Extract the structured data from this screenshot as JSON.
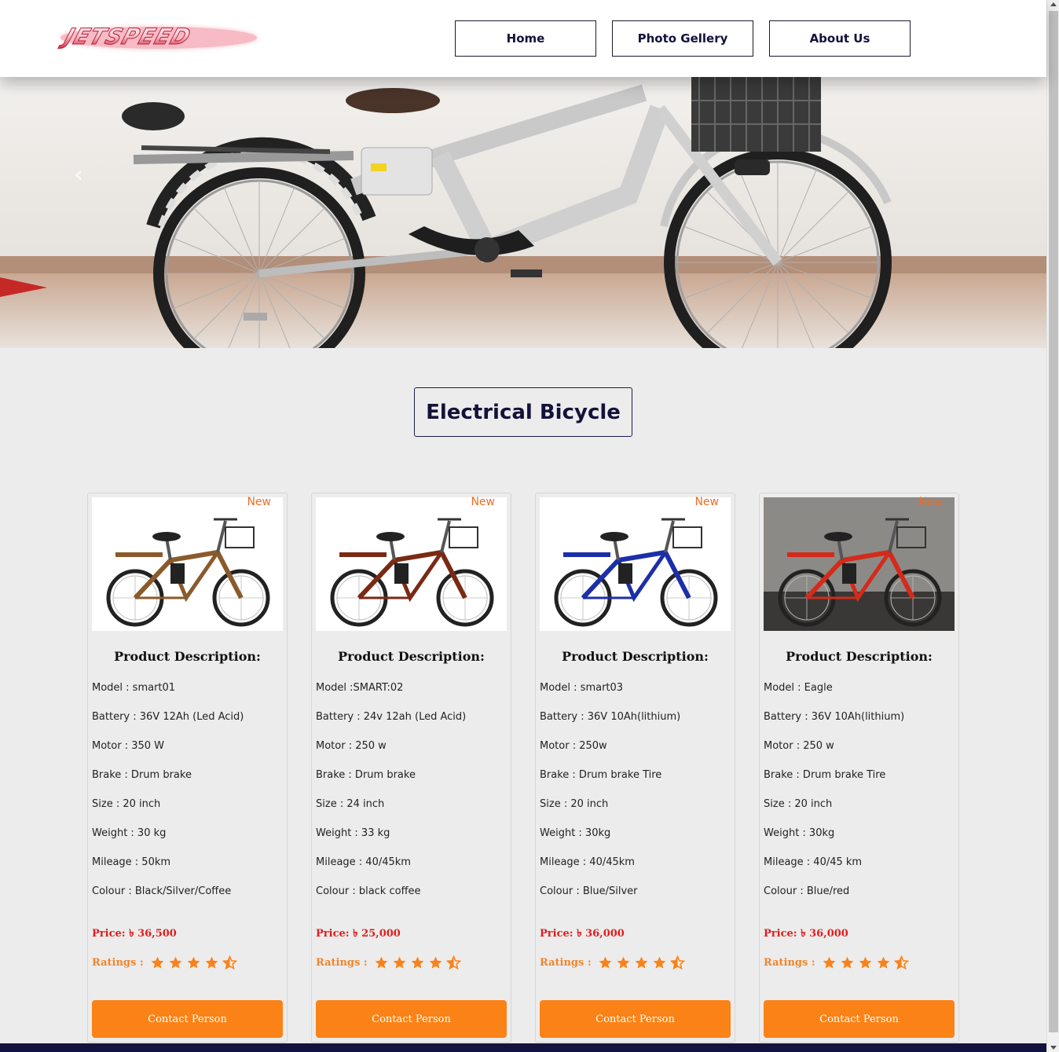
{
  "header": {
    "logo_text": "JETSPEED",
    "nav": [
      {
        "label": "Home"
      },
      {
        "label": "Photo Gellery"
      },
      {
        "label": "About Us"
      }
    ]
  },
  "section": {
    "title": "Electrical Bicycle"
  },
  "products": [
    {
      "badge": "New",
      "desc_title": "Product Description:",
      "specs": [
        "Model : smart01",
        "Battery : 36V 12Ah (Led Acid)",
        "Motor : 350 W",
        "Brake : Drum brake",
        "Size : 20 inch",
        "Weight : 30 kg",
        "Mileage : 50km",
        "Colour : Black/Silver/Coffee"
      ],
      "price": "Price: ৳ 36,500",
      "ratings_label": "Ratings :",
      "rating": 4.5,
      "contact_label": "Contact Person",
      "frame_color": "#8b5a2b"
    },
    {
      "badge": "New",
      "desc_title": "Product Description:",
      "specs": [
        "Model :SMART:02",
        "Battery : 24v 12ah (Led Acid)",
        "Motor : 250 w",
        "Brake : Drum brake",
        "Size : 24 inch",
        "Weight : 33 kg",
        "Mileage : 40/45km",
        "Colour : black coffee"
      ],
      "price": "Price: ৳ 25,000",
      "ratings_label": "Ratings :",
      "rating": 4.5,
      "contact_label": "Contact Person",
      "frame_color": "#7a2a14"
    },
    {
      "badge": "New",
      "desc_title": "Product Description:",
      "specs": [
        "Model : smart03",
        "Battery : 36V 10Ah(lithium)",
        "Motor : 250w",
        "Brake : Drum brake Tire",
        "Size : 20 inch",
        "Weight : 30kg",
        "Mileage : 40/45km",
        "Colour : Blue/Silver"
      ],
      "price": "Price: ৳ 36,000",
      "ratings_label": "Ratings :",
      "rating": 4.5,
      "contact_label": "Contact Person",
      "frame_color": "#1c2fa8"
    },
    {
      "badge": "New",
      "desc_title": "Product Description:",
      "specs": [
        "Model : Eagle",
        "Battery : 36V 10Ah(lithium)",
        "Motor : 250 w",
        "Brake : Drum brake Tire",
        "Size : 20 inch",
        "Weight : 30kg",
        "Mileage : 40/45 km",
        "Colour : Blue/red"
      ],
      "price": "Price: ৳ 36,000",
      "ratings_label": "Ratings :",
      "rating": 4.5,
      "contact_label": "Contact Person",
      "frame_color": "#d42a1a"
    }
  ],
  "colors": {
    "accent": "#fb8217",
    "navy": "#12123a",
    "price": "#e11d1d",
    "badge": "#f06c22"
  }
}
